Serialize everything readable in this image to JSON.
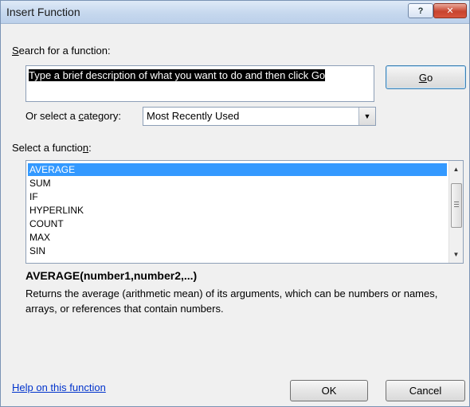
{
  "window": {
    "title": "Insert Function",
    "help_glyph": "?",
    "close_glyph": "✕"
  },
  "search": {
    "label_mnemonic": "S",
    "label_rest": "earch for a function:",
    "value": "Type a brief description of what you want to do and then click Go",
    "go_mnemonic": "G",
    "go_rest": "o"
  },
  "category": {
    "label_before": "Or select a ",
    "label_mnemonic": "c",
    "label_after": "ategory:",
    "selected": "Most Recently Used"
  },
  "function_list": {
    "label_before": "Select a functio",
    "label_mnemonic": "n",
    "label_after": ":",
    "items": [
      "AVERAGE",
      "SUM",
      "IF",
      "HYPERLINK",
      "COUNT",
      "MAX",
      "SIN"
    ],
    "selected_index": 0
  },
  "details": {
    "signature": "AVERAGE(number1,number2,...)",
    "description": "Returns the average (arithmetic mean) of its arguments, which can be numbers or names, arrays, or references that contain numbers."
  },
  "footer": {
    "help_link": "Help on this function",
    "ok": "OK",
    "cancel": "Cancel"
  }
}
